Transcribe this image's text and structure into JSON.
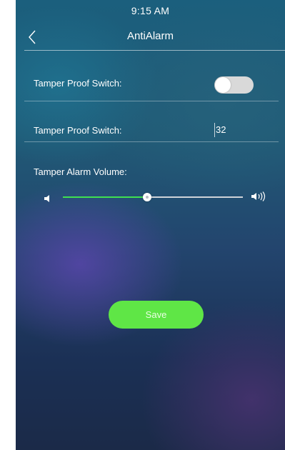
{
  "status_bar": {
    "time": "9:15 AM"
  },
  "header": {
    "title": "AntiAlarm",
    "back_icon": "chevron-left-icon"
  },
  "settings": {
    "tamper_switch": {
      "label": "Tamper Proof Switch:",
      "enabled": false
    },
    "tamper_value": {
      "label": "Tamper Proof Switch:",
      "value": "32"
    },
    "volume": {
      "label": "Tamper Alarm Volume:",
      "level": 0.47,
      "low_icon": "volume-low-icon",
      "high_icon": "volume-high-icon"
    }
  },
  "actions": {
    "save_label": "Save"
  },
  "colors": {
    "accent": "#5fe646",
    "slider_fill": "#3fe050",
    "toggle_off": "#d9d9d9",
    "background_top": "#1b5f7d",
    "background_bottom": "#1b2a48"
  }
}
